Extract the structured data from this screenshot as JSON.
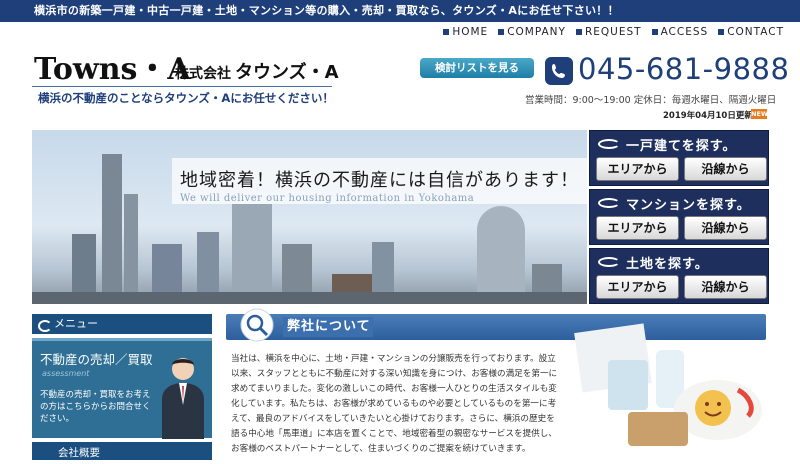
{
  "top_bar": {
    "text": "横浜市の新築一戸建・中古一戸建・土地・マンション等の購入・売却・買取なら、タウンズ・Aにお任せ下さい！！"
  },
  "nav": {
    "items": [
      "HOME",
      "COMPANY",
      "REQUEST",
      "ACCESS",
      "CONTACT"
    ]
  },
  "header": {
    "logo": "Towns・A",
    "company_prefix": "株式会社",
    "company_name": "タウンズ・A",
    "tagline": "横浜の不動産のことならタウンズ・Aにお任せください！",
    "review_button": "検討リストを見る",
    "phone": "045-681-9888",
    "hours": "営業時間：9:00～19:00 定休日：毎週水曜日、隔週火曜日",
    "update_date": "2019年04月10日更新",
    "new_badge": "NEW"
  },
  "hero": {
    "title": "地域密着！横浜の不動産には自信があります！",
    "subtitle": "We will deliver our housing information in Yokohama"
  },
  "search": [
    {
      "title": "一戸建てを探す。",
      "area": "エリアから",
      "line": "沿線から"
    },
    {
      "title": "マンションを探す。",
      "area": "エリアから",
      "line": "沿線から"
    },
    {
      "title": "土地を探す。",
      "area": "エリアから",
      "line": "沿線から"
    }
  ],
  "menu": {
    "heading": "メニュー",
    "sell_title": "不動産の売却／買取",
    "sell_en": "assessment",
    "sell_text": "不動産の売却・買取をお考えの方はこちらからお問合せください。",
    "overview_heading": "会社概要"
  },
  "about": {
    "heading": "弊社について",
    "text": "当社は、横浜を中心に、土地・戸建・マンションの分譲販売を行っております。設立以来、スタッフとともに不動産に対する深い知識を身につけ、お客様の満足を第一に求めてまいりました。変化の激しいこの時代、お客様一人ひとりの生活スタイルも変化しています。私たちは、お客様が求めているものや必要としているものを第一に考えて、最良のアドバイスをしていきたいと心掛けております。さらに、横浜の歴史を語る中心地「馬車道」に本店を置くことで、地域密着型の親密なサービスを提供し、お客様のベストパートナーとして、住まいづくりのご提案を続けていきます。"
  },
  "colors": {
    "primary": "#1e3f7a",
    "search_bg": "#1e2f5e",
    "menu_bg": "#2f6f95",
    "accent": "#e87b1e"
  }
}
